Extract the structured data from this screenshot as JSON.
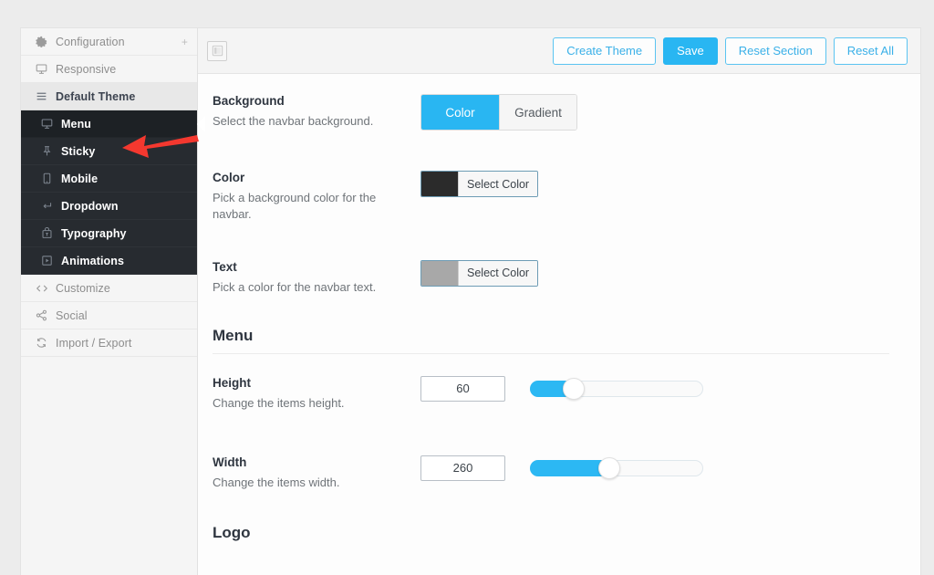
{
  "sidebar": {
    "items": [
      {
        "label": "Configuration",
        "icon": "gear-icon",
        "style": "light",
        "trailing": "+"
      },
      {
        "label": "Responsive",
        "icon": "monitor-icon",
        "style": "light",
        "trailing": ""
      },
      {
        "label": "Default Theme",
        "icon": "menu-lines-icon",
        "style": "group-active",
        "trailing": ""
      },
      {
        "label": "Menu",
        "icon": "monitor-icon",
        "style": "dark-selected",
        "trailing": ""
      },
      {
        "label": "Sticky",
        "icon": "pin-icon",
        "style": "dark",
        "trailing": ""
      },
      {
        "label": "Mobile",
        "icon": "mobile-icon",
        "style": "dark",
        "trailing": ""
      },
      {
        "label": "Dropdown",
        "icon": "return-arrow-icon",
        "style": "dark",
        "trailing": ""
      },
      {
        "label": "Typography",
        "icon": "typography-icon",
        "style": "dark",
        "trailing": ""
      },
      {
        "label": "Animations",
        "icon": "play-box-icon",
        "style": "dark",
        "trailing": ""
      },
      {
        "label": "Customize",
        "icon": "code-icon",
        "style": "light",
        "trailing": ""
      },
      {
        "label": "Social",
        "icon": "share-icon",
        "style": "light",
        "trailing": ""
      },
      {
        "label": "Import / Export",
        "icon": "refresh-icon",
        "style": "light",
        "trailing": ""
      }
    ]
  },
  "toolbar": {
    "toggle_icon": "sidebar-toggle-icon",
    "create_theme_label": "Create Theme",
    "save_label": "Save",
    "reset_section_label": "Reset Section",
    "reset_all_label": "Reset All"
  },
  "fields": {
    "background": {
      "title": "Background",
      "description": "Select the navbar background.",
      "options": [
        "Color",
        "Gradient"
      ],
      "selected": "Color"
    },
    "color": {
      "title": "Color",
      "description": "Pick a background color for the navbar.",
      "button_label": "Select Color",
      "swatch": "#2b2b2b"
    },
    "text": {
      "title": "Text",
      "description": "Pick a color for the navbar text.",
      "button_label": "Select Color",
      "swatch": "#a8a8a8"
    },
    "height": {
      "title": "Height",
      "description": "Change the items height.",
      "value": "60",
      "slider_percent": 25
    },
    "width": {
      "title": "Width",
      "description": "Change the items width.",
      "value": "260",
      "slider_percent": 46
    }
  },
  "sections": {
    "menu_heading": "Menu",
    "logo_heading": "Logo"
  },
  "colors": {
    "accent": "#29b6f2",
    "dark_nav": "#272b30",
    "dark_nav_selected": "#1d2125",
    "annotation_arrow": "#f4382f"
  }
}
